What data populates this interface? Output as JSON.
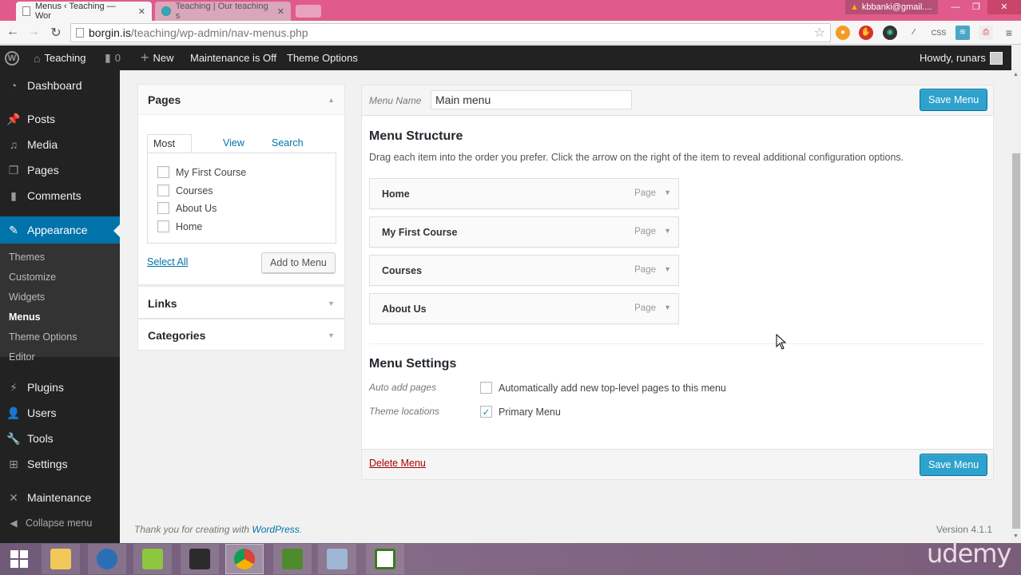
{
  "browser": {
    "tabs": [
      {
        "title": "Menus ‹ Teaching — Wor",
        "active": true
      },
      {
        "title": "Teaching | Our teaching s",
        "active": false
      }
    ],
    "account": "kbbanki@gmail....",
    "url_host": "borgin.is",
    "url_path": "/teaching/wp-admin/nav-menus.php",
    "extensions": [
      "firefox-like-icon",
      "stop-icon",
      "color-wheel-icon",
      "eyedropper-icon",
      "css-icon",
      "wave-icon",
      "pdf-icon"
    ],
    "css_ext_label": "CSS"
  },
  "adminbar": {
    "site_name": "Teaching",
    "comments_count": "0",
    "new_label": "New",
    "maintenance": "Maintenance is Off",
    "theme_options": "Theme Options",
    "howdy": "Howdy, runars"
  },
  "sidebar": {
    "items": [
      {
        "label": "Dashboard",
        "icon": "dashboard-icon"
      },
      {
        "label": "Posts",
        "icon": "pin-icon"
      },
      {
        "label": "Media",
        "icon": "media-icon"
      },
      {
        "label": "Pages",
        "icon": "pages-icon"
      },
      {
        "label": "Comments",
        "icon": "comment-icon"
      },
      {
        "label": "Appearance",
        "icon": "paintbrush-icon",
        "current": true
      },
      {
        "label": "Plugins",
        "icon": "plugin-icon"
      },
      {
        "label": "Users",
        "icon": "user-icon"
      },
      {
        "label": "Tools",
        "icon": "wrench-icon"
      },
      {
        "label": "Settings",
        "icon": "settings-icon"
      },
      {
        "label": "Maintenance",
        "icon": "tools-cross-icon"
      }
    ],
    "submenu": [
      "Themes",
      "Customize",
      "Widgets",
      "Menus",
      "Theme Options",
      "Editor"
    ],
    "submenu_current": "Menus",
    "collapse": "Collapse menu"
  },
  "left_panel": {
    "pages": {
      "title": "Pages",
      "tabs": [
        "Most Recent",
        "View All",
        "Search"
      ],
      "active_tab": "Most Recent",
      "items": [
        "My First Course",
        "Courses",
        "About Us",
        "Home"
      ],
      "select_all": "Select All",
      "add_button": "Add to Menu"
    },
    "links_title": "Links",
    "categories_title": "Categories"
  },
  "menu_editor": {
    "menu_name_label": "Menu Name",
    "menu_name_value": "Main menu",
    "save_label": "Save Menu",
    "structure_title": "Menu Structure",
    "structure_desc": "Drag each item into the order you prefer. Click the arrow on the right of the item to reveal additional configuration options.",
    "items": [
      {
        "title": "Home",
        "type": "Page"
      },
      {
        "title": "My First Course",
        "type": "Page"
      },
      {
        "title": "Courses",
        "type": "Page"
      },
      {
        "title": "About Us",
        "type": "Page"
      }
    ],
    "settings_title": "Menu Settings",
    "auto_add_label": "Auto add pages",
    "auto_add_text": "Automatically add new top-level pages to this menu",
    "auto_add_checked": false,
    "locations_label": "Theme locations",
    "primary_menu_text": "Primary Menu",
    "primary_menu_checked": true,
    "delete_label": "Delete Menu"
  },
  "footer": {
    "thanks": "Thank you for creating with ",
    "wp_link": "WordPress",
    "period": ".",
    "version": "Version 4.1.1"
  },
  "taskbar": {
    "apps": [
      "windows-start",
      "file-explorer",
      "thunderbird",
      "notepad-plus-plus",
      "powershell",
      "chrome",
      "camtasia",
      "virtualbox",
      "camtasia-recorder"
    ],
    "watermark": "udemy"
  },
  "colors": {
    "accent": "#0073aa",
    "primary_button": "#2ea2cc",
    "admin_bar": "#222222",
    "delete": "#aa0000",
    "browser_frame": "#e05b8a"
  }
}
